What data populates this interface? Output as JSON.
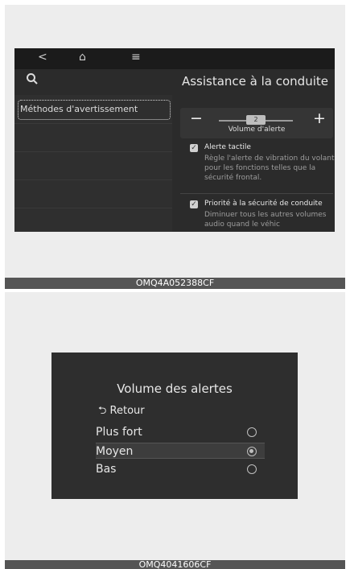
{
  "screen1": {
    "nav": {
      "back_icon": "<",
      "home_icon": "⌂",
      "menu_icon": "≡"
    },
    "search_icon": "search-icon",
    "title": "Assistance à la conduite",
    "menu_item": "Méthodes d'avertissement",
    "volume": {
      "minus": "−",
      "plus": "+",
      "level": "2",
      "label": "Volume d'alerte"
    },
    "options": [
      {
        "title": "Alerte tactile",
        "desc": "Règle l'alerte de vibration du volant pour les fonctions telles que la sécurité frontal."
      },
      {
        "title": "Priorité à la sécurité de conduite",
        "desc": "Diminuer tous les autres volumes audio quand le véhic"
      }
    ],
    "caption": "OMQ4A052388CF"
  },
  "screen2": {
    "title": "Volume des alertes",
    "back": "⮌ Retour",
    "items": [
      {
        "label": "Plus fort",
        "selected": false
      },
      {
        "label": "Moyen",
        "selected": true
      },
      {
        "label": "Bas",
        "selected": false
      }
    ],
    "caption": "OMQ4041606CF"
  }
}
